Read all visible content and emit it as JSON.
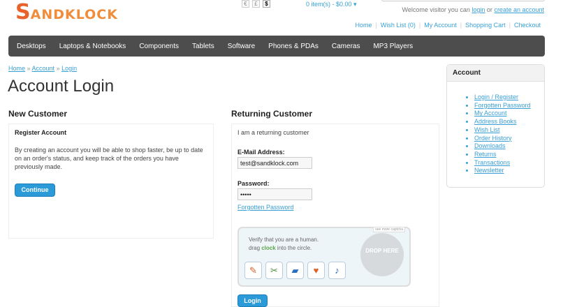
{
  "header": {
    "logo_s": "S",
    "logo_text": "ANDKLOCK",
    "currencies": [
      "€",
      "£",
      "$"
    ],
    "cart_text": "0 item(s) - $0.00 ▾",
    "welcome_prefix": "Welcome visitor you can ",
    "login_link": "login",
    "welcome_or": " or ",
    "create_link": "create an account",
    "top_links": [
      "Home",
      "Wish List (0)",
      "My Account",
      "Shopping Cart",
      "Checkout"
    ]
  },
  "menu": [
    "Desktops",
    "Laptops & Notebooks",
    "Components",
    "Tablets",
    "Software",
    "Phones & PDAs",
    "Cameras",
    "MP3 Players"
  ],
  "breadcrumb": [
    "Home",
    "Account",
    "Login"
  ],
  "page_title": "Account Login",
  "new_customer": {
    "title": "New Customer",
    "subtitle": "Register Account",
    "text": "By creating an account you will be able to shop faster, be up to date on an order's status, and keep track of the orders you have previously made.",
    "button": "Continue"
  },
  "returning_customer": {
    "title": "Returning Customer",
    "intro": "I am a returning customer",
    "email_label": "E-Mail Address:",
    "email_value": "test@sandklock.com",
    "password_label": "Password:",
    "password_value": "•••••",
    "forgot_link": "Forgotten Password",
    "button": "Login"
  },
  "captcha": {
    "tag": "see more captcha",
    "line1": "Verify that you are a human.",
    "line2_prefix": "drag ",
    "line2_highlight": "clock",
    "line2_suffix": " into the circle.",
    "drop_text": "DROP HERE",
    "icons": [
      "pencil-icon",
      "scissors-icon",
      "book-icon",
      "heart-icon",
      "music-note-icon"
    ]
  },
  "sidebar": {
    "title": "Account",
    "links": [
      "Login / Register",
      "Forgotten Password",
      "My Account",
      "Address Books",
      "Wish List",
      "Order History",
      "Downloads",
      "Returns",
      "Transactions",
      "Newsletter"
    ]
  },
  "colors": {
    "accent": "#2b9ad9",
    "link": "#38a0d6",
    "menu_bg": "#4d4d4d",
    "logo": "#e8632b"
  }
}
